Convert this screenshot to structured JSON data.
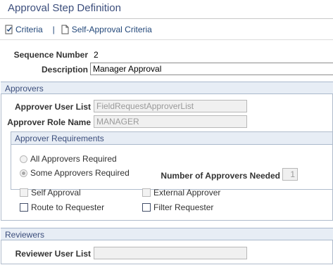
{
  "page": {
    "title": "Approval Step Definition"
  },
  "links": {
    "criteria": "Criteria",
    "separator": "|",
    "self_approval_criteria": "Self-Approval Criteria"
  },
  "fields": {
    "sequence_number_label": "Sequence Number",
    "sequence_number_value": "2",
    "description_label": "Description",
    "description_value": "Manager Approval"
  },
  "approvers": {
    "header": "Approvers",
    "user_list_label": "Approver User List",
    "user_list_value": "FieldRequestApproverList",
    "role_name_label": "Approver Role Name",
    "role_name_value": "MANAGER"
  },
  "requirements": {
    "header": "Approver Requirements",
    "all_required_label": "All Approvers Required",
    "some_required_label": "Some Approvers Required",
    "selected": "some",
    "num_needed_label": "Number of Approvers Needed",
    "num_needed_value": "1"
  },
  "options": {
    "self_approval": "Self Approval",
    "external_approver": "External Approver",
    "route_to_requester": "Route to Requester",
    "filter_requester": "Filter Requester"
  },
  "reviewers": {
    "header": "Reviewers",
    "user_list_label": "Reviewer User List",
    "user_list_value": ""
  },
  "colors": {
    "title": "#3c4e7c",
    "link": "#23487a",
    "section_bg": "#e7edf5"
  }
}
